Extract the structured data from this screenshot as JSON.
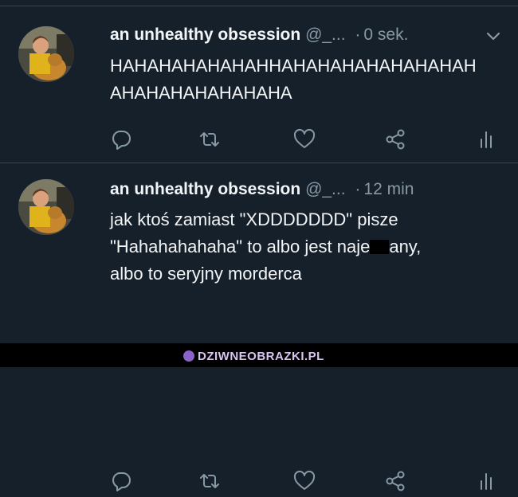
{
  "tweets": [
    {
      "name": "an unhealthy obsession",
      "handle": "@_...",
      "time": "0 sek.",
      "lines": [
        "HAHAHAHAHAHAHHAHAHAHAHAHAHAHAH",
        "AHAHAHAHAHAHAHA"
      ]
    },
    {
      "name": "an unhealthy obsession",
      "handle": "@_...",
      "time": "12 min",
      "line1": "jak ktoś zamiast \"XDDDDDDD\" pisze",
      "line2_before": "\"Hahahahahaha\" to albo jest naje",
      "line2_after": "any,",
      "line3": "albo to seryjny morderca"
    }
  ],
  "icons": [
    "reply-icon",
    "retweet-icon",
    "like-icon",
    "share-icon",
    "analytics-icon"
  ],
  "colors": {
    "background": "#15202b",
    "text": "#f3f5f7",
    "secondary": "#8899a6",
    "divider": "#38444d"
  },
  "watermark": {
    "text": "DZIWNEOBRAZKI.PL"
  }
}
